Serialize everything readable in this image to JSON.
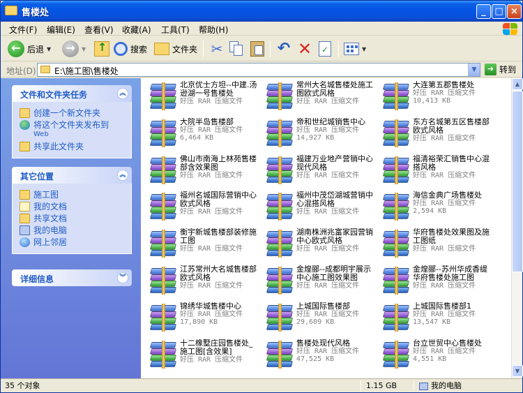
{
  "window": {
    "title": "售楼处"
  },
  "menu": [
    "文件(F)",
    "编辑(E)",
    "查看(V)",
    "收藏(A)",
    "工具(T)",
    "帮助(H)"
  ],
  "toolbar": {
    "back": "后退",
    "search": "搜索",
    "folders": "文件夹"
  },
  "address": {
    "label": "地址(D)",
    "path": "E:\\施工图\\售楼处",
    "go": "转到"
  },
  "sidebar": {
    "tasks": {
      "title": "文件和文件夹任务",
      "items": [
        "创建一个新文件夹",
        "将这个文件夹发布到",
        "共享此文件夹"
      ],
      "publish_sub": "Web"
    },
    "places": {
      "title": "其它位置",
      "items": [
        "施工图",
        "我的文档",
        "共享文档",
        "我的电脑",
        "网上邻居"
      ]
    },
    "details": {
      "title": "详细信息"
    }
  },
  "files": [
    {
      "name": "北京优士方坦--中建.汤逊湖一号售楼处",
      "type": "好压 RAR 压缩文件",
      "size": ""
    },
    {
      "name": "常州大名城售楼处施工图欧式风格",
      "type": "好压 RAR 压缩文件",
      "size": ""
    },
    {
      "name": "大连第五郡售楼处",
      "type": "好压 RAR 压缩文件",
      "size": "10,413 KB"
    },
    {
      "name": "大院半岛售楼部",
      "type": "好压 RAR 压缩文件",
      "size": "6,464 KB"
    },
    {
      "name": "帝和世纪城销售中心",
      "type": "好压 RAR 压缩文件",
      "size": "14,927 KB"
    },
    {
      "name": "东方名城第五区售楼部欧式风格",
      "type": "好压 RAR 压缩文件",
      "size": ""
    },
    {
      "name": "佛山市南海上林苑售楼部含效果图",
      "type": "好压 RAR 压缩文件",
      "size": ""
    },
    {
      "name": "福建万业地产营销中心现代风格",
      "type": "好压 RAR 压缩文件",
      "size": ""
    },
    {
      "name": "福清裕荣汇销售中心混搭风格",
      "type": "好压 RAR 压缩文件",
      "size": ""
    },
    {
      "name": "福州名城国际营销中心欧式风格",
      "type": "好压 RAR 压缩文件",
      "size": ""
    },
    {
      "name": "福州中茂岱湖城营销中心混搭风格",
      "type": "好压 RAR 压缩文件",
      "size": ""
    },
    {
      "name": "海信金典广场售楼处",
      "type": "好压 RAR 压缩文件",
      "size": "2,594 KB"
    },
    {
      "name": "衡宇新城售楼部装修施工图",
      "type": "好压 RAR 压缩文件",
      "size": ""
    },
    {
      "name": "湖南株洲兆富家园营销中心欧式风格",
      "type": "好压 RAR 压缩文件",
      "size": ""
    },
    {
      "name": "华府售楼处效果图及施工图纸",
      "type": "好压 RAR 压缩文件",
      "size": ""
    },
    {
      "name": "江苏常州大名城售楼部欧式风格",
      "type": "好压 RAR 压缩文件",
      "size": ""
    },
    {
      "name": "金煌郦--成都明宇展示中心施工图效果图",
      "type": "好压 RAR 压缩文件",
      "size": ""
    },
    {
      "name": "金煌郦--苏州华成香缇华府售楼处施工图",
      "type": "好压 RAR 压缩文件",
      "size": ""
    },
    {
      "name": "锦绣华城售楼中心",
      "type": "好压 RAR 压缩文件",
      "size": "17,890 KB"
    },
    {
      "name": "上城国际售楼部",
      "type": "好压 RAR 压缩文件",
      "size": "29,609 KB"
    },
    {
      "name": "上城国际售楼部1",
      "type": "好压 RAR 压缩文件",
      "size": "13,547 KB"
    },
    {
      "name": "十二橡墅庄园售楼处_施工图[含效果]",
      "type": "好压 RAR 压缩文件",
      "size": ""
    },
    {
      "name": "售楼处现代风格",
      "type": "好压 RAR 压缩文件",
      "size": "47,525 KB"
    },
    {
      "name": "台立世贸中心售楼处",
      "type": "好压 RAR 压缩文件",
      "size": "4,551 KB"
    }
  ],
  "status": {
    "count": "35 个对象",
    "size": "1.15 GB",
    "location": "我的电脑"
  }
}
